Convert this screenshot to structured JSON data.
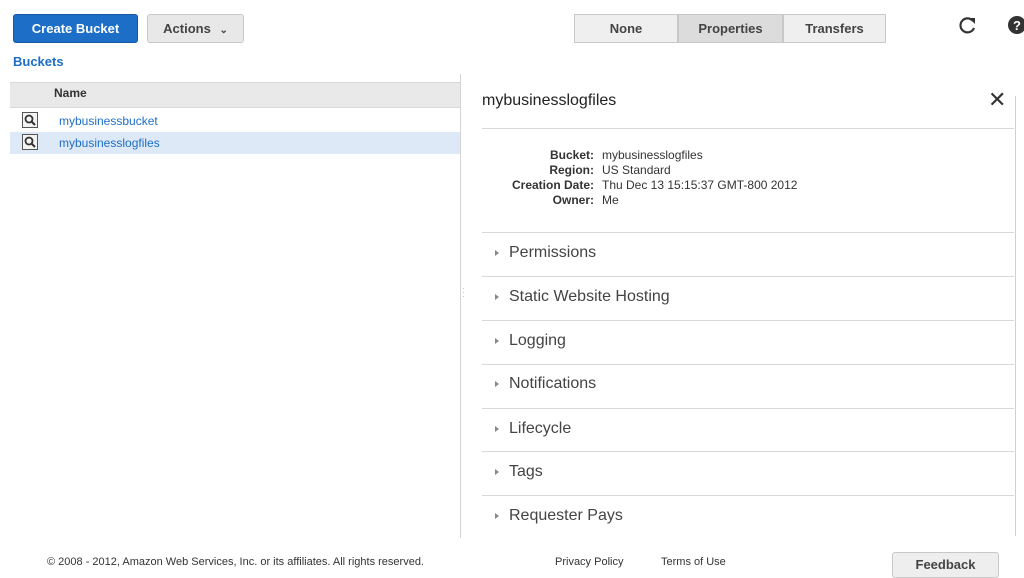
{
  "toolbar": {
    "create_bucket_label": "Create Bucket",
    "actions_label": "Actions",
    "view_options": [
      "None",
      "Properties",
      "Transfers"
    ],
    "active_view": "Properties",
    "refresh_icon": "refresh-icon",
    "help_icon": "help-icon"
  },
  "sidebar": {
    "title": "Buckets",
    "column_header": "Name",
    "buckets": [
      {
        "name": "mybusinessbucket",
        "selected": false
      },
      {
        "name": "mybusinesslogfiles",
        "selected": true
      }
    ]
  },
  "properties": {
    "title": "mybusinesslogfiles",
    "details": [
      {
        "key": "Bucket:",
        "value": "mybusinesslogfiles"
      },
      {
        "key": "Region:",
        "value": "US Standard"
      },
      {
        "key": "Creation Date:",
        "value": "Thu Dec 13 15:15:37 GMT-800 2012"
      },
      {
        "key": "Owner:",
        "value": "Me"
      }
    ],
    "sections": [
      "Permissions",
      "Static Website Hosting",
      "Logging",
      "Notifications",
      "Lifecycle",
      "Tags",
      "Requester Pays"
    ]
  },
  "footer": {
    "copyright": "© 2008 - 2012, Amazon Web Services, Inc. or its affiliates. All rights reserved.",
    "privacy_link": "Privacy Policy",
    "terms_link": "Terms of Use",
    "feedback_label": "Feedback"
  },
  "colors": {
    "accent": "#1d6ec7",
    "selected_row": "#dde9f7"
  }
}
